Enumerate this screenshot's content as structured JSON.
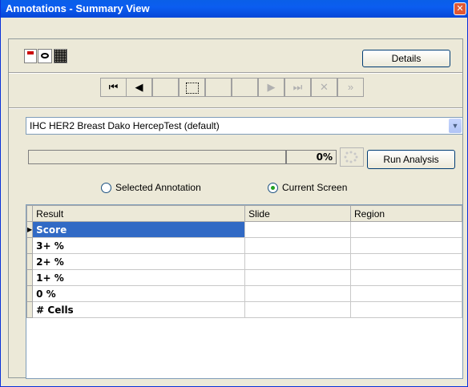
{
  "window": {
    "title": "Annotations - Summary View"
  },
  "toolbar": {
    "details_label": "Details"
  },
  "nav": {
    "buttons": [
      {
        "name": "first-icon",
        "glyph": "⏮"
      },
      {
        "name": "prev-icon",
        "glyph": "◀"
      },
      {
        "name": "blank1",
        "glyph": ""
      },
      {
        "name": "select-rect-icon",
        "glyph": ""
      },
      {
        "name": "blank2",
        "glyph": ""
      },
      {
        "name": "blank3",
        "glyph": ""
      },
      {
        "name": "next-icon",
        "glyph": "▶"
      },
      {
        "name": "last-icon",
        "glyph": "⏭"
      },
      {
        "name": "delete-icon",
        "glyph": "✕"
      },
      {
        "name": "delete-all-icon",
        "glyph": "»"
      }
    ]
  },
  "algorithm": {
    "selected": "IHC HER2 Breast Dako HercepTest (default)"
  },
  "progress": {
    "value_percent": 0,
    "label": "0%"
  },
  "actions": {
    "run_label": "Run Analysis"
  },
  "scope": {
    "options": [
      {
        "label": "Selected Annotation",
        "selected": false
      },
      {
        "label": "Current Screen",
        "selected": true
      }
    ]
  },
  "results": {
    "columns": [
      "Result",
      "Slide",
      "Region"
    ],
    "rows": [
      {
        "result": "Score",
        "slide": "",
        "region": ""
      },
      {
        "result": "3+ %",
        "slide": "",
        "region": ""
      },
      {
        "result": "2+ %",
        "slide": "",
        "region": ""
      },
      {
        "result": "1+ %",
        "slide": "",
        "region": ""
      },
      {
        "result": "0  %",
        "slide": "",
        "region": ""
      },
      {
        "result": "# Cells",
        "slide": "",
        "region": ""
      }
    ]
  },
  "colors": {
    "titlebar": "#0b5df0",
    "selection": "#316ac5"
  }
}
